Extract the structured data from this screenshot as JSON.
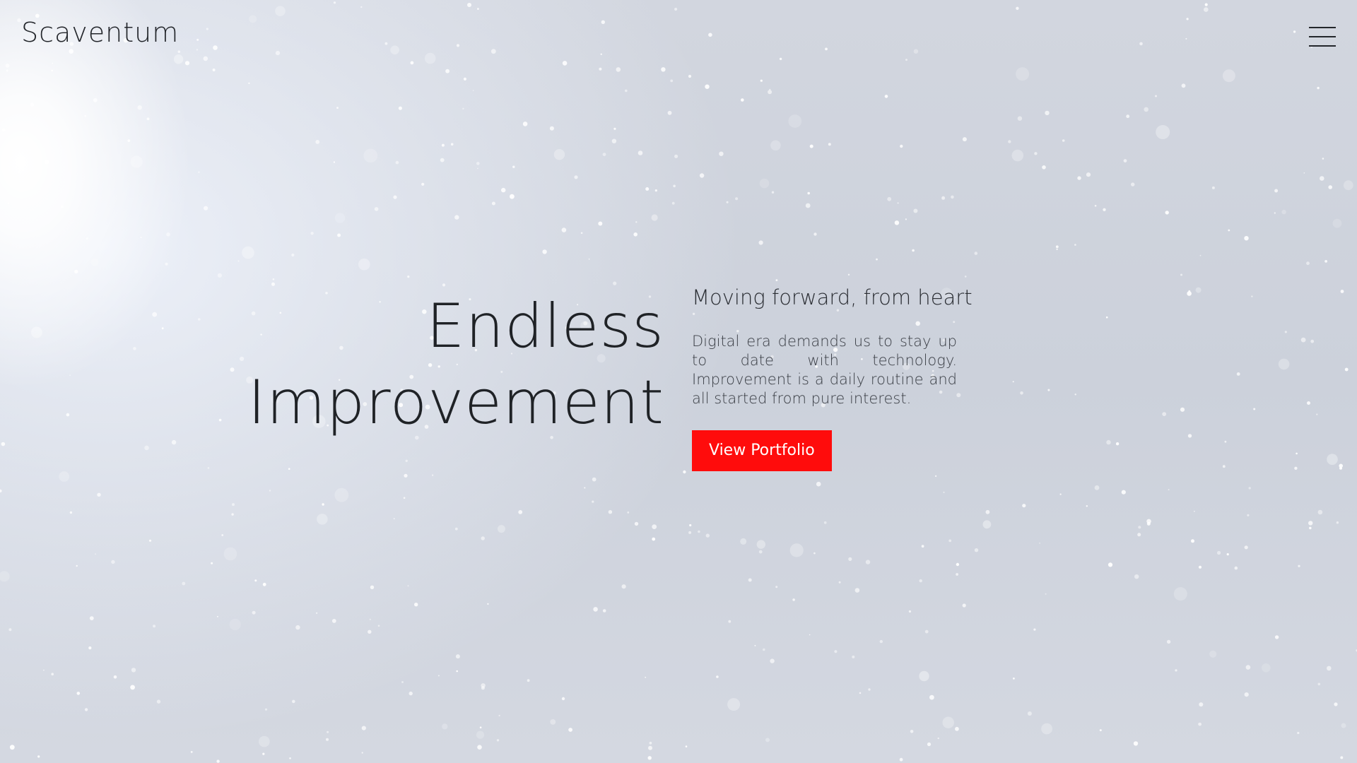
{
  "header": {
    "brand": "Scaventum",
    "menu_icon": "hamburger-menu-icon"
  },
  "hero": {
    "title_line1": "Endless",
    "title_line2": "Improvement",
    "tagline": "Moving forward, from heart",
    "description": "Digital era demands us to stay up to date with technology. Improvement is a daily routine and all started from pure interest.",
    "cta_label": "View Portfolio"
  },
  "colors": {
    "accent": "#ff0c0c",
    "text": "#1f2226",
    "background": "#cdd2dc"
  }
}
